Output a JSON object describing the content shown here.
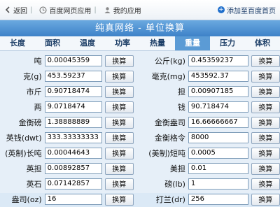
{
  "topbar": {
    "back": "返回",
    "recent": "百度网页应用",
    "mine": "我的应用",
    "add_home": "添加至百度首页"
  },
  "header": {
    "title": "纯真网络 - 单位换算"
  },
  "tabs": [
    "长度",
    "面积",
    "温度",
    "功率",
    "热量",
    "重量",
    "压力",
    "体积"
  ],
  "active_tab": "重量",
  "convert_label": "换算",
  "rows": [
    {
      "l_label": "吨",
      "l_val": "0.00045359",
      "r_label": "公斤(kg)",
      "r_val": "0.45359237"
    },
    {
      "l_label": "克(g)",
      "l_val": "453.59237",
      "r_label": "毫克(mg)",
      "r_val": "453592.37"
    },
    {
      "l_label": "市斤",
      "l_val": "0.90718474",
      "r_label": "担",
      "r_val": "0.00907185"
    },
    {
      "l_label": "两",
      "l_val": "9.0718474",
      "r_label": "钱",
      "r_val": "90.718474"
    },
    {
      "l_label": "金衡磅",
      "l_val": "1.38888889",
      "r_label": "金衡盎司",
      "r_val": "16.66666667"
    },
    {
      "l_label": "英钱(dwt)",
      "l_val": "333.33333333",
      "r_label": "金衡格令",
      "r_val": "8000"
    },
    {
      "l_label": "(英制)长吨",
      "l_val": "0.00044643",
      "r_label": "(美制)短吨",
      "r_val": "0.0005"
    },
    {
      "l_label": "英担",
      "l_val": "0.00892857",
      "r_label": "美担",
      "r_val": "0.01"
    },
    {
      "l_label": "英石",
      "l_val": "0.07142857",
      "r_label": "磅(lb)",
      "r_val": "1"
    },
    {
      "l_label": "盎司(oz)",
      "l_val": "16",
      "r_label": "打兰(dr)",
      "r_val": "256"
    }
  ]
}
